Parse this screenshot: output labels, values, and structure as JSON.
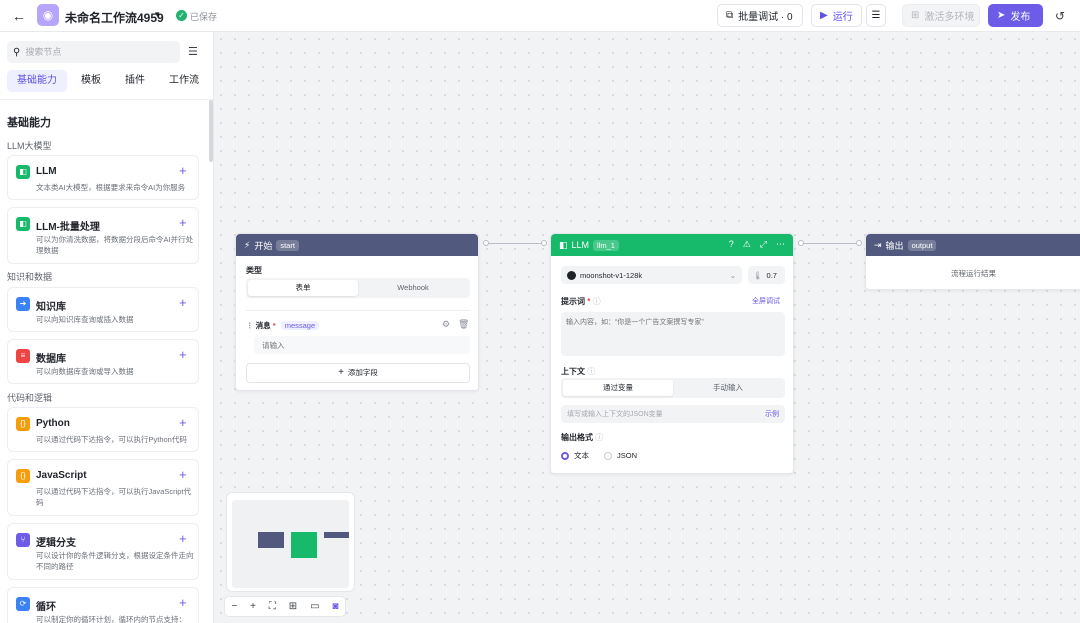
{
  "header": {
    "title": "未命名工作流4959",
    "saved": "已保存",
    "batch_debug": "批量调试 · 0",
    "run": "运行",
    "activate_env": "激活多环境",
    "publish": "发布"
  },
  "sidebar": {
    "search_placeholder": "搜索节点",
    "tabs": [
      "基础能力",
      "模板",
      "插件",
      "工作流"
    ],
    "section_title": "基础能力",
    "groups": [
      "LLM大模型",
      "知识和数据",
      "代码和逻辑"
    ],
    "cards": [
      {
        "name": "LLM",
        "desc": "文本类AI大模型，根据要求来命令AI为你服务",
        "color": "#17b96b"
      },
      {
        "name": "LLM-批量处理",
        "desc": "可以为你清洗数据，将数据分段后命令AI并行处理数据",
        "color": "#17b96b"
      },
      {
        "name": "知识库",
        "desc": "可以向知识库查询或插入数据",
        "color": "#3b82f6"
      },
      {
        "name": "数据库",
        "desc": "可以向数据库查询或导入数据",
        "color": "#ef4444"
      },
      {
        "name": "Python",
        "desc": "可以通过代码下达指令，可以执行Python代码",
        "color": "#f59e0b"
      },
      {
        "name": "JavaScript",
        "desc": "可以通过代码下达指令，可以执行JavaScript代码",
        "color": "#f59e0b"
      },
      {
        "name": "逻辑分支",
        "desc": "可以设计你的条件逻辑分支，根据设定条件走向不同的路径",
        "color": "#6c5ce7"
      },
      {
        "name": "循环",
        "desc": "可以制定你的循环计划，循环内的节点支持：",
        "color": "#3b82f6"
      }
    ]
  },
  "nodes": {
    "start": {
      "title": "开始",
      "tag": "start",
      "color": "#515a7e",
      "type_label": "类型",
      "tabs": [
        "表单",
        "Webhook"
      ],
      "field_name": "消息",
      "field_tag": "message",
      "field_placeholder": "请输入",
      "add_field": "添加字段"
    },
    "llm": {
      "title": "LLM",
      "tag": "llm_1",
      "color": "#17b96b",
      "model": "moonshot-v1-128k",
      "temperature": "0.7",
      "prompt_label": "提示词",
      "fullscreen_debug": "全屏调试",
      "prompt_placeholder": "输入内容，如：“你是一个广告文案撰写专家”",
      "context_label": "上下文",
      "context_tabs": [
        "通过变量",
        "手动输入"
      ],
      "context_placeholder": "填写或输入上下文的JSON变量",
      "example": "示例",
      "output_label": "输出格式",
      "formats": [
        "文本",
        "JSON"
      ]
    },
    "output": {
      "title": "输出",
      "tag": "output",
      "color": "#515a7e",
      "desc": "流程运行结果"
    }
  }
}
